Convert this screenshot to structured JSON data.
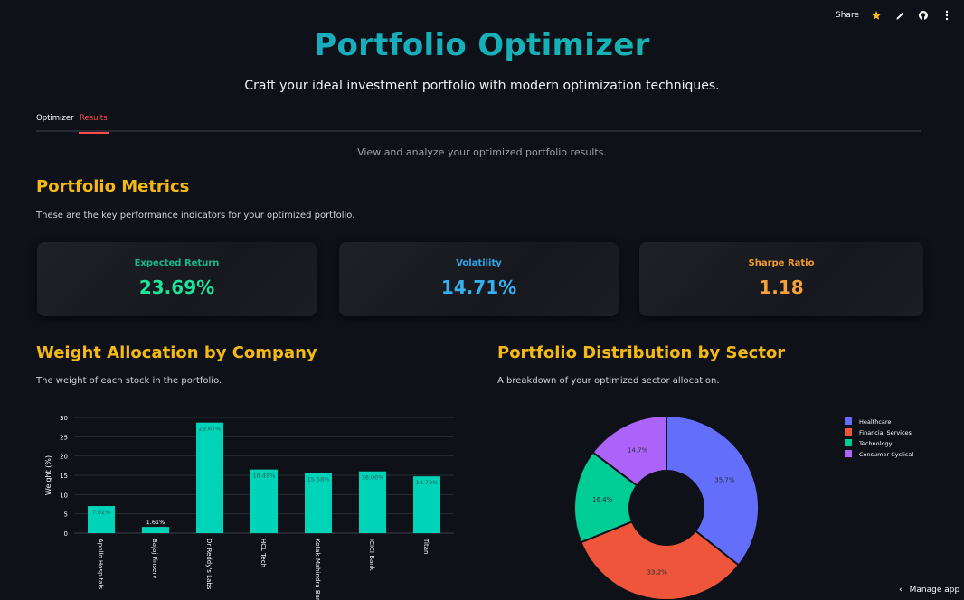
{
  "topbar": {
    "share_label": "Share"
  },
  "header": {
    "title": "Portfolio Optimizer",
    "subtitle": "Craft your ideal investment portfolio with modern optimization techniques."
  },
  "tabs": [
    {
      "label": "Optimizer",
      "active": false
    },
    {
      "label": "Results",
      "active": true
    }
  ],
  "results": {
    "caption": "View and analyze your optimized portfolio results.",
    "metrics_title": "Portfolio Metrics",
    "metrics_desc": "These are the key performance indicators for your optimized portfolio.",
    "metrics": [
      {
        "label": "Expected Return",
        "value": "23.69%",
        "color": "#14b88a",
        "value_color": "#1de39b"
      },
      {
        "label": "Volatility",
        "value": "14.71%",
        "color": "#2fa6e8",
        "value_color": "#34b1ee"
      },
      {
        "label": "Sharpe Ratio",
        "value": "1.18",
        "color": "#f39c2b",
        "value_color": "#f6a13a"
      }
    ],
    "weight_title": "Weight Allocation by Company",
    "weight_desc": "The weight of each stock in the portfolio.",
    "sector_title": "Portfolio Distribution by Sector",
    "sector_desc": "A breakdown of your optimized sector allocation."
  },
  "footer": {
    "manage_label": "Manage app"
  },
  "chart_data": [
    {
      "type": "bar",
      "title": "",
      "xlabel": "",
      "ylabel": "Weight (%)",
      "ylim": [
        0,
        30
      ],
      "yticks": [
        0,
        5,
        10,
        15,
        20,
        25,
        30
      ],
      "categories": [
        "Apollo Hospitals",
        "Bajaj Finserv",
        "Dr Reddy's Labs",
        "HCL Tech",
        "Kotak Mahindra Bank",
        "ICICI Bank",
        "Titan"
      ],
      "values": [
        7.02,
        1.61,
        28.67,
        16.49,
        15.58,
        16.0,
        14.72
      ],
      "data_labels": [
        "7.02%",
        "1.61%",
        "28.67%",
        "16.49%",
        "15.58%",
        "16.00%",
        "14.72%"
      ],
      "color": "#00d4b8",
      "grid": true
    },
    {
      "type": "pie",
      "donut": true,
      "labels": [
        "Healthcare",
        "Financial Services",
        "Technology",
        "Consumer Cyclical"
      ],
      "values": [
        35.7,
        33.2,
        16.4,
        14.7
      ],
      "data_labels": [
        "35.7%",
        "33.2%",
        "16.4%",
        "14.7%"
      ],
      "colors": [
        "#636efa",
        "#ef553b",
        "#00cc96",
        "#ab63fa"
      ],
      "legend": "right"
    }
  ]
}
